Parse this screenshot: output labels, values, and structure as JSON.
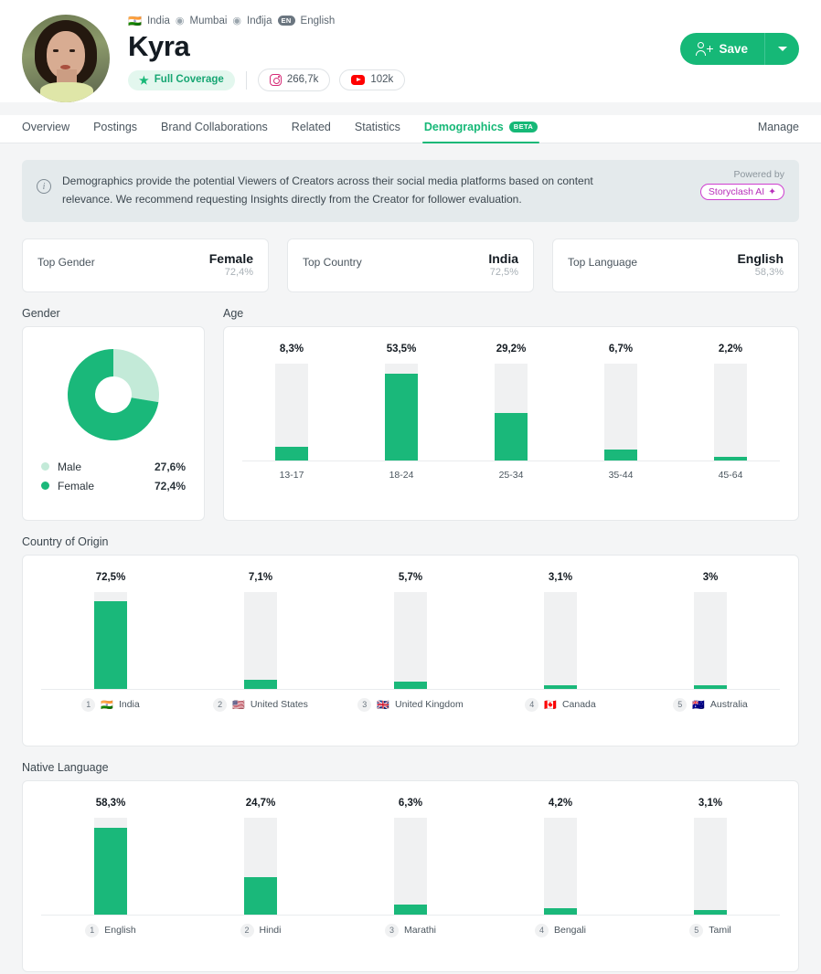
{
  "header": {
    "meta": {
      "country_flag": "🇮🇳",
      "country": "India",
      "city": "Mumbai",
      "city_alt": "Inđija",
      "language_badge": "EN",
      "language": "English"
    },
    "name": "Kyra",
    "coverage_label": "Full Coverage",
    "metrics": [
      {
        "platform": "instagram",
        "value": "266,7k"
      },
      {
        "platform": "youtube",
        "value": "102k"
      }
    ],
    "save_label": "Save",
    "manage_label": "Manage"
  },
  "tabs": [
    {
      "label": "Overview",
      "active": false
    },
    {
      "label": "Postings",
      "active": false
    },
    {
      "label": "Brand Collaborations",
      "active": false
    },
    {
      "label": "Related",
      "active": false
    },
    {
      "label": "Statistics",
      "active": false
    },
    {
      "label": "Demographics",
      "active": true,
      "badge": "BETA"
    }
  ],
  "banner": {
    "text": "Demographics provide the potential Viewers of Creators across their social media platforms based on content relevance. We recommend requesting Insights directly from the Creator for follower evaluation.",
    "powered_by_label": "Powered by",
    "powered_by_brand": "Storyclash AI"
  },
  "summary_cards": [
    {
      "label": "Top Gender",
      "value": "Female",
      "pct": "72,4%"
    },
    {
      "label": "Top Country",
      "value": "India",
      "pct": "72,5%"
    },
    {
      "label": "Top Language",
      "value": "English",
      "pct": "58,3%"
    }
  ],
  "sections": {
    "gender": "Gender",
    "age": "Age",
    "country": "Country of Origin",
    "language": "Native Language"
  },
  "colors": {
    "accent_green": "#1ab87a",
    "light_green": "#c3ead8",
    "track_gray": "#f0f1f2",
    "brand_magenta": "#cf3fd0"
  },
  "chart_data": [
    {
      "type": "pie",
      "title": "Gender",
      "categories": [
        "Male",
        "Female"
      ],
      "values": [
        27.6,
        72.4
      ],
      "value_labels": [
        "27,6%",
        "72,4%"
      ],
      "colors": [
        "#c3ead8",
        "#1ab87a"
      ],
      "legend": "bottom-left"
    },
    {
      "type": "bar",
      "title": "Age",
      "categories": [
        "13-17",
        "18-24",
        "25-34",
        "35-44",
        "45-64"
      ],
      "values": [
        8.3,
        53.5,
        29.2,
        6.7,
        2.2
      ],
      "value_labels": [
        "8,3%",
        "53,5%",
        "29,2%",
        "6,7%",
        "2,2%"
      ],
      "ylabel": "",
      "xlabel": "",
      "ylim": [
        0,
        60
      ],
      "grid": false
    },
    {
      "type": "bar",
      "title": "Country of Origin",
      "categories": [
        "India",
        "United States",
        "United Kingdom",
        "Canada",
        "Australia"
      ],
      "ranks": [
        "1",
        "2",
        "3",
        "4",
        "5"
      ],
      "flags": [
        "🇮🇳",
        "🇺🇸",
        "🇬🇧",
        "🇨🇦",
        "🇦🇺"
      ],
      "values": [
        72.5,
        7.1,
        5.7,
        3.1,
        3.0
      ],
      "value_labels": [
        "72,5%",
        "7,1%",
        "5,7%",
        "3,1%",
        "3%"
      ],
      "ylim": [
        0,
        80
      ],
      "grid": false
    },
    {
      "type": "bar",
      "title": "Native Language",
      "categories": [
        "English",
        "Hindi",
        "Marathi",
        "Bengali",
        "Tamil"
      ],
      "ranks": [
        "1",
        "2",
        "3",
        "4",
        "5"
      ],
      "values": [
        58.3,
        24.7,
        6.3,
        4.2,
        3.1
      ],
      "value_labels": [
        "58,3%",
        "24,7%",
        "6,3%",
        "4,2%",
        "3,1%"
      ],
      "ylim": [
        0,
        65
      ],
      "grid": false
    }
  ]
}
